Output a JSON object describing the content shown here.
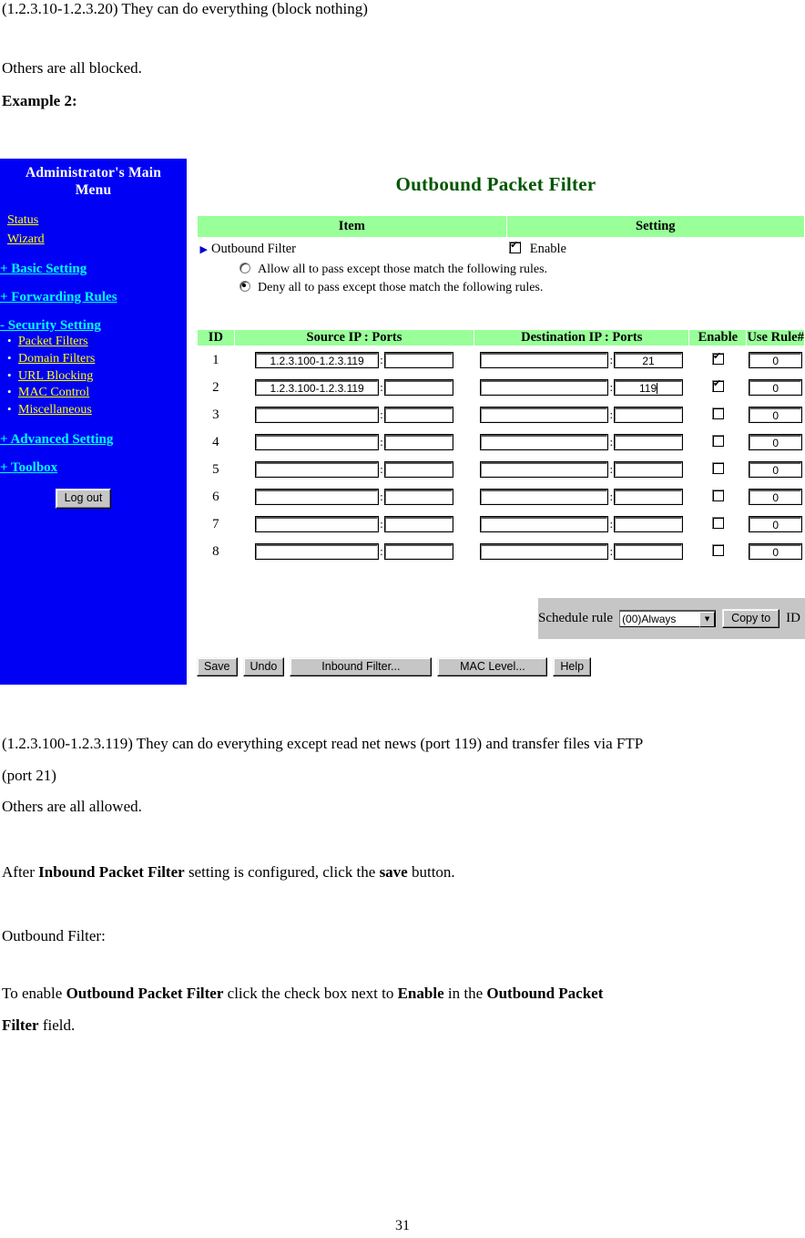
{
  "document": {
    "para_top": "(1.2.3.10-1.2.3.20) They can do everything (block nothing)",
    "para_others_blocked": "Others are all blocked.",
    "para_example2": "Example 2:",
    "para_range": "(1.2.3.100-1.2.3.119) They can do everything except read net news (port 119) and transfer files via FTP",
    "para_port21": "(port 21)",
    "para_allowed": "Others are all allowed.",
    "para_after": "After Inbound Packet Filter setting is configured, click the save button.",
    "para_outbound": "Outbound Filter:",
    "para_toenable_1": "To enable Outbound Packet Filter click the check box next to Enable in the Outbound Packet",
    "para_toenable_2": "Filter field.",
    "page_number": "31"
  },
  "router_ui": {
    "sidebar": {
      "title_line1": "Administrator's Main",
      "title_line2": "Menu",
      "top_links": [
        {
          "label": "Status"
        },
        {
          "label": "Wizard"
        }
      ],
      "categories": [
        {
          "label": "+ Basic Setting",
          "expanded": false
        },
        {
          "label": "+ Forwarding Rules",
          "expanded": false
        },
        {
          "label": "- Security Setting",
          "expanded": true,
          "children": [
            {
              "label": "Packet Filters"
            },
            {
              "label": "Domain Filters"
            },
            {
              "label": "URL Blocking"
            },
            {
              "label": "MAC Control"
            },
            {
              "label": "Miscellaneous"
            }
          ]
        },
        {
          "label": "+ Advanced Setting",
          "expanded": false
        },
        {
          "label": "+ Toolbox",
          "expanded": false
        }
      ],
      "logout_label": "Log out",
      "colors": {
        "background": "#0000f5",
        "category_link": "#00ffff",
        "sub_link": "#ffff00",
        "title": "#ffffff"
      }
    },
    "panel": {
      "title": "Outbound Packet Filter",
      "title_color": "#005500",
      "header_bg": "#99ff99",
      "item_table": {
        "col_item": "Item",
        "col_setting": "Setting",
        "row_label": "Outbound Filter",
        "enable_label": "Enable",
        "enable_checked": true,
        "mode_options": [
          {
            "label": "Allow all to pass except those match the following rules.",
            "selected": false
          },
          {
            "label": "Deny all to pass except those match the following rules.",
            "selected": true
          }
        ]
      },
      "rules_table": {
        "columns": [
          "ID",
          "Source IP : Ports",
          "Destination IP : Ports",
          "Enable",
          "Use Rule#"
        ],
        "rows": [
          {
            "id": "1",
            "src_ip": "1.2.3.100-1.2.3.119",
            "src_port": "",
            "dst_ip": "",
            "dst_port": "21",
            "enable": true,
            "use_rule": "0",
            "caret": false
          },
          {
            "id": "2",
            "src_ip": "1.2.3.100-1.2.3.119",
            "src_port": "",
            "dst_ip": "",
            "dst_port": "119",
            "enable": true,
            "use_rule": "0",
            "caret": true
          },
          {
            "id": "3",
            "src_ip": "",
            "src_port": "",
            "dst_ip": "",
            "dst_port": "",
            "enable": false,
            "use_rule": "0",
            "caret": false
          },
          {
            "id": "4",
            "src_ip": "",
            "src_port": "",
            "dst_ip": "",
            "dst_port": "",
            "enable": false,
            "use_rule": "0",
            "caret": false
          },
          {
            "id": "5",
            "src_ip": "",
            "src_port": "",
            "dst_ip": "",
            "dst_port": "",
            "enable": false,
            "use_rule": "0",
            "caret": false
          },
          {
            "id": "6",
            "src_ip": "",
            "src_port": "",
            "dst_ip": "",
            "dst_port": "",
            "enable": false,
            "use_rule": "0",
            "caret": false
          },
          {
            "id": "7",
            "src_ip": "",
            "src_port": "",
            "dst_ip": "",
            "dst_port": "",
            "enable": false,
            "use_rule": "0",
            "caret": false
          },
          {
            "id": "8",
            "src_ip": "",
            "src_port": "",
            "dst_ip": "",
            "dst_port": "",
            "enable": false,
            "use_rule": "0",
            "caret": false
          }
        ]
      },
      "schedule": {
        "label": "Schedule rule",
        "rule_value": "(00)Always",
        "copy_to_label": "Copy to",
        "id_label": "ID",
        "id_value": "--"
      },
      "buttons": [
        {
          "label": "Save"
        },
        {
          "label": "Undo"
        },
        {
          "label": "Inbound Filter..."
        },
        {
          "label": "MAC Level..."
        },
        {
          "label": "Help"
        }
      ]
    }
  }
}
